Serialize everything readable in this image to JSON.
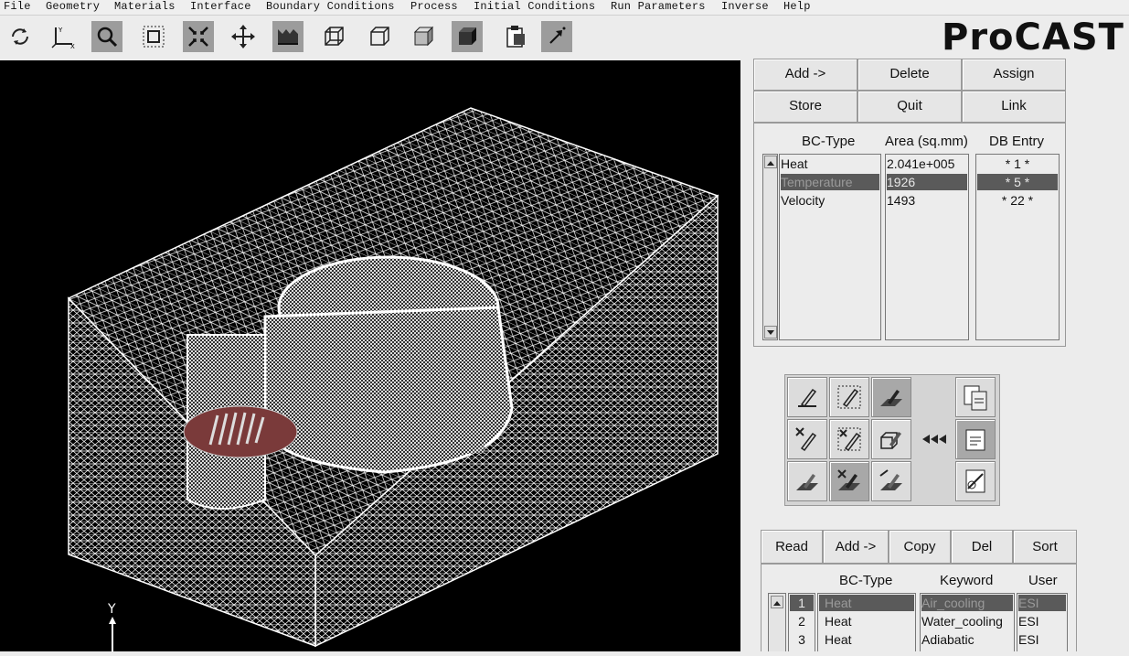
{
  "menu": [
    "File",
    "Geometry",
    "Materials",
    "Interface",
    "Boundary Conditions",
    "Process",
    "Initial Conditions",
    "Run Parameters",
    "Inverse",
    "Help"
  ],
  "toolbar": {
    "icons": [
      "rotate-icon",
      "axes-icon",
      "zoom-icon",
      "fit-view-icon",
      "shrink-icon",
      "pan-icon",
      "mesh-surface-icon",
      "wireframe-cube-icon",
      "hidden-line-cube-icon",
      "shaded-cube-icon",
      "solid-cube-icon",
      "clipboard-icon",
      "pointer-arrow-icon"
    ]
  },
  "logo": "ProCAST",
  "viewport": {
    "axis_label": "Y"
  },
  "bc_buttons": [
    "Add ->",
    "Delete",
    "Assign",
    "Store",
    "Quit",
    "Link"
  ],
  "bc_table": {
    "headers": [
      "BC-Type",
      "Area (sq.mm)",
      "DB Entry"
    ],
    "rows": [
      {
        "type": "Heat",
        "area": "2.041e+005",
        "db": "* 1 *",
        "selected": false
      },
      {
        "type": "Temperature",
        "area": "1926",
        "db": "* 5 *",
        "selected": true
      },
      {
        "type": "Velocity",
        "area": "1493",
        "db": "* 22 *",
        "selected": false
      }
    ]
  },
  "tool_icons": [
    "assign-face-icon",
    "assign-face-box-icon",
    "assign-volume-icon",
    "copy-db-icon",
    "remove-face-icon",
    "remove-face-box-icon",
    "add-volume-icon",
    "transfer-arrows-icon",
    "db-folder-icon",
    "surface-select-icon",
    "surface-remove-icon",
    "surface-edit-icon",
    "clear-db-icon"
  ],
  "db_buttons": [
    "Read",
    "Add ->",
    "Copy",
    "Del",
    "Sort"
  ],
  "db_table": {
    "headers": [
      "BC-Type",
      "Keyword",
      "User"
    ],
    "rows": [
      {
        "num": "1",
        "type": "Heat",
        "keyword": "Air_cooling",
        "user": "ESI",
        "selected": true
      },
      {
        "num": "2",
        "type": "Heat",
        "keyword": "Water_cooling",
        "user": "ESI",
        "selected": false
      },
      {
        "num": "3",
        "type": "Heat",
        "keyword": "Adiabatic",
        "user": "ESI",
        "selected": false
      }
    ]
  },
  "colors": {
    "viewport_bg": "#000000",
    "mesh": "#ffffff",
    "selection": "#5a5a5a",
    "highlight_patch": "#7a3a3a"
  }
}
